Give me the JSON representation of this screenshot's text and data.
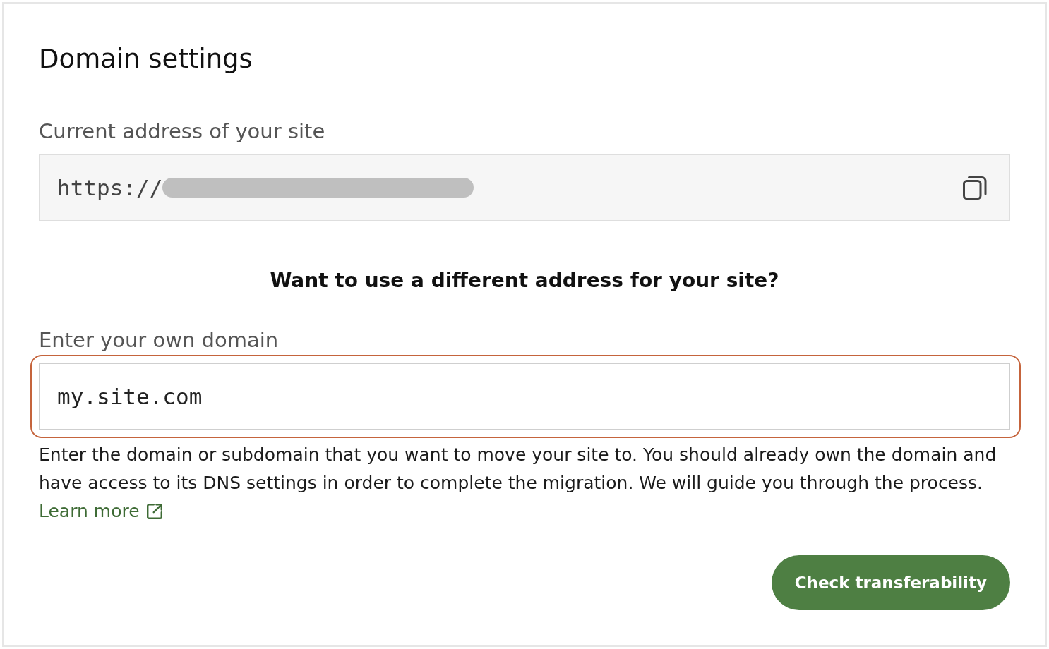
{
  "title": "Domain settings",
  "current_address": {
    "label": "Current address of your site",
    "prefix": "https://",
    "redacted": true
  },
  "divider_heading": "Want to use a different address for your site?",
  "domain_field": {
    "label": "Enter your own domain",
    "value": "my.site.com",
    "focused": true
  },
  "help_text": "Enter the domain or subdomain that you want to move your site to. You should already own the domain and have access to its DNS settings in order to complete the migration. We will guide you through the process.",
  "learn_more_link": "Learn more",
  "button": "Check transferability"
}
